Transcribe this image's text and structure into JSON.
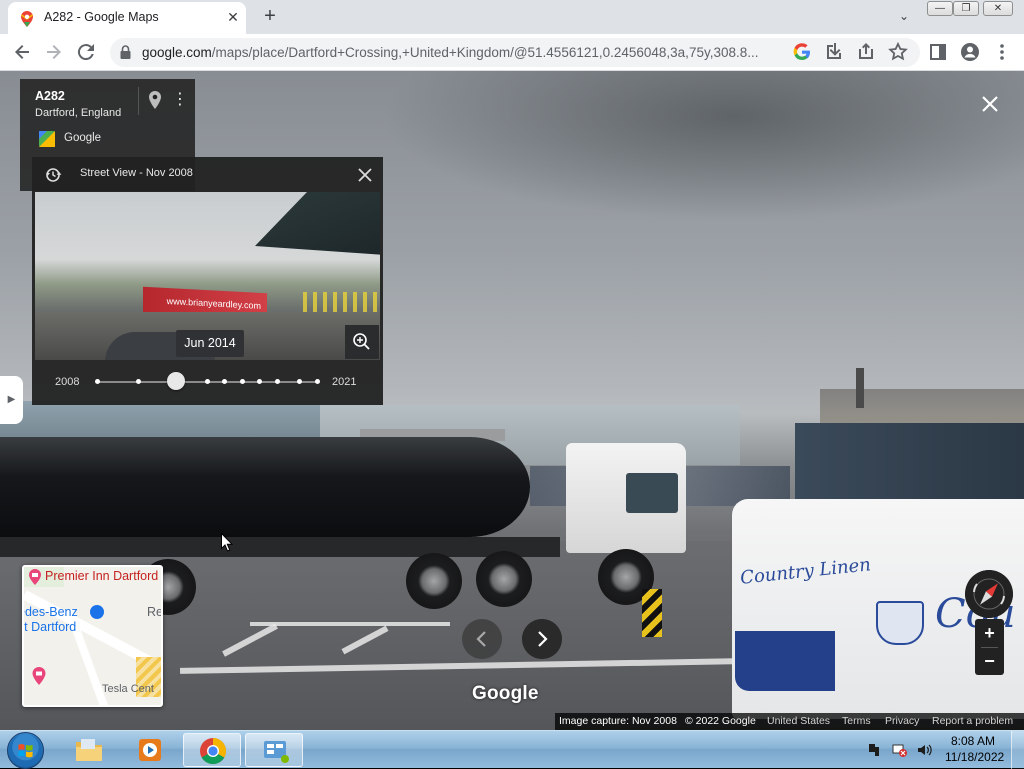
{
  "browser": {
    "tab_title": "A282 - Google Maps",
    "tab_close": "✕",
    "new_tab": "+",
    "tab_search": "⌄",
    "url_host": "google.com",
    "url_path": "/maps/place/Dartford+Crossing,+United+Kingdom/@51.4556121,0.2456048,3a,75y,308.8...",
    "window_min": "—",
    "window_max": "❐",
    "window_close": "✕"
  },
  "placecard": {
    "road": "A282",
    "city": "Dartford, England",
    "provider": "Google",
    "more": "⋮"
  },
  "time_machine": {
    "title": "Street View - Nov 2008",
    "tooltip": "Jun 2014",
    "sign_text": "www.brianyeardley.com",
    "year_from": "2008",
    "year_to": "2021",
    "selected_fraction": 0.36
  },
  "minimap": {
    "hotel": "Premier Inn Dartford",
    "benz": "edes-Benz",
    "dartford": "rt Dartford",
    "rec": "Rec",
    "tesla": "Tesla Cent"
  },
  "scene": {
    "van_text": "Country Linen",
    "van_big": "Cou"
  },
  "controls": {
    "zoom_in": "+",
    "zoom_out": "−"
  },
  "watermark": "Google",
  "footer": {
    "capture": "Image capture: Nov 2008",
    "copyright": "© 2022 Google",
    "region": "United States",
    "terms": "Terms",
    "privacy": "Privacy",
    "report": "Report a problem"
  },
  "taskbar": {
    "time": "8:08 AM",
    "date": "11/18/2022"
  },
  "colors": {
    "maps_red": "#ea4335",
    "maps_blue": "#1a73e8",
    "chrome_tab_bg": "#dee1e6",
    "taskbar": "#8ab4d6"
  }
}
